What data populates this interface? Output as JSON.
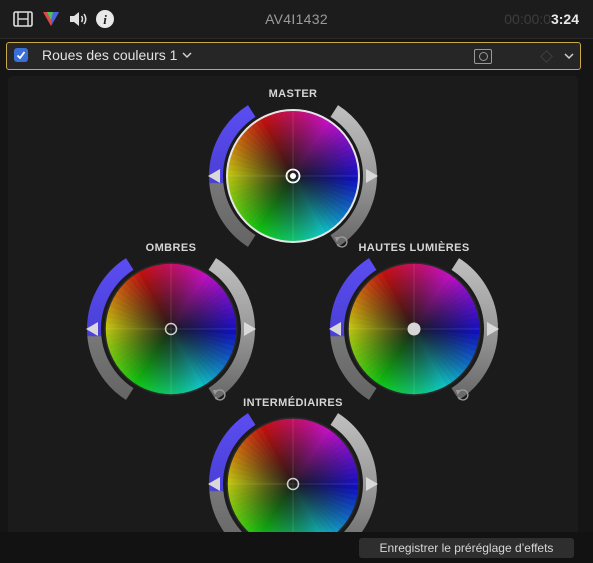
{
  "topbar": {
    "title": "AV4I1432",
    "timecode_dim": "00:00:0",
    "timecode_bright": "3:24",
    "icons": [
      "film-strip-icon",
      "color-prism-icon",
      "speaker-icon",
      "info-icon"
    ]
  },
  "effect": {
    "name": "Roues des couleurs 1",
    "enabled": true
  },
  "wheels": [
    {
      "id": "master",
      "label": "MASTER"
    },
    {
      "id": "shadows",
      "label": "OMBRES"
    },
    {
      "id": "highlights",
      "label": "HAUTES LUMIÈRES"
    },
    {
      "id": "midtones",
      "label": "INTERMÉDIAIRES"
    }
  ],
  "footer": {
    "save_preset_label": "Enregistrer le préréglage d’effets"
  },
  "colors": {
    "accent_border": "#c9a94a",
    "checkbox": "#3b6fd8",
    "saturation_slider": "#4a3fd6",
    "brightness_slider": "#8a8a8a"
  }
}
